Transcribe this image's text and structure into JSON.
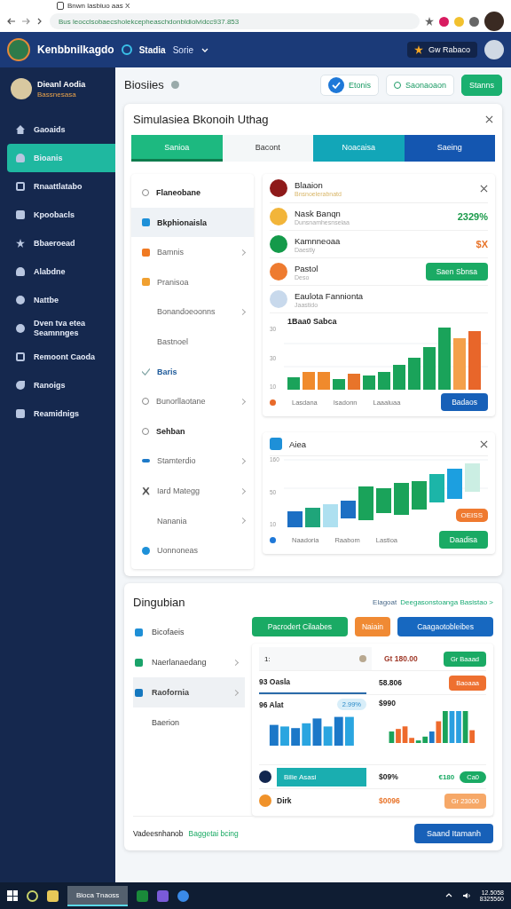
{
  "browser": {
    "tab_title": "Bnwn lasbiuo aas X",
    "url": "Bus leocclsobaecsholekcepheaschdonbldiolvidcc937.853"
  },
  "header": {
    "brand": "Kenbbnilkagdo",
    "nav": [
      {
        "label": "Stadia",
        "selected": true
      },
      {
        "label": "Sorie",
        "selected": false
      }
    ],
    "user": "Gw Rabaco"
  },
  "sidebar": {
    "profile": {
      "name": "Dieanl Aodia",
      "role": "Bassnesasa"
    },
    "items": [
      {
        "label": "Gaoaids",
        "selected": false
      },
      {
        "label": "Bioanis",
        "selected": true
      },
      {
        "label": "Rnaattlatabo",
        "selected": false
      },
      {
        "label": "Kpoobacls",
        "selected": false
      },
      {
        "label": "Bbaeroead",
        "selected": false
      },
      {
        "label": "Alabdne",
        "selected": false
      },
      {
        "label": "Nattbe",
        "selected": false
      },
      {
        "label": "Dven tva etea Seamnnges",
        "selected": false
      },
      {
        "label": "Remoont Caoda",
        "selected": false
      },
      {
        "label": "Ranoigs",
        "selected": false
      },
      {
        "label": "Reamidnigs",
        "selected": false
      }
    ]
  },
  "page": {
    "title": "Biosiies",
    "buttons": [
      {
        "label": "Etonis",
        "kind": "check"
      },
      {
        "label": "Saonaoaon",
        "kind": "outline"
      },
      {
        "label": "Stanns",
        "kind": "primary"
      }
    ]
  },
  "dialog": {
    "title": "Simulasiea Bkonoih Uthag",
    "tabs": [
      {
        "label": "Sanioa",
        "selected": true,
        "color": "#1db980"
      },
      {
        "label": "Bacont",
        "selected": false,
        "color": "#f4f7f8"
      },
      {
        "label": "Noacaisa",
        "selected": false,
        "color": "#12a6b8"
      },
      {
        "label": "Saeing",
        "selected": false,
        "color": "#1456b0"
      }
    ],
    "menu": [
      {
        "label": "Flaneobane",
        "arrow": false,
        "selected": false,
        "bold": true
      },
      {
        "label": "Bkphionaisla",
        "arrow": false,
        "selected": true,
        "bold": true
      },
      {
        "label": "Bamnis",
        "arrow": true,
        "selected": false,
        "bold": false
      },
      {
        "label": "Pranisoa",
        "arrow": false,
        "selected": false,
        "bold": false
      },
      {
        "label": "Bonandoeoonns",
        "arrow": true,
        "selected": false,
        "bold": false
      },
      {
        "label": "Bastnoel",
        "arrow": false,
        "selected": false,
        "bold": false
      },
      {
        "label": "Baris",
        "arrow": false,
        "selected": false,
        "bold": true
      },
      {
        "label": "Bunorllaotane",
        "arrow": true,
        "selected": false,
        "bold": false
      },
      {
        "label": "Sehban",
        "arrow": false,
        "selected": false,
        "bold": true
      },
      {
        "label": "Stamterdio",
        "arrow": true,
        "selected": false,
        "bold": false
      },
      {
        "label": "Iard Mategg",
        "arrow": true,
        "selected": false,
        "bold": false
      },
      {
        "label": "Nanania",
        "arrow": true,
        "selected": false,
        "bold": false
      },
      {
        "label": "Uonnoneas",
        "arrow": false,
        "selected": false,
        "bold": false
      }
    ],
    "card1": {
      "title": "Blaaion",
      "subtitle": "Bnsnoelerabnatd",
      "rows": [
        {
          "name": "Nask Banqn",
          "sub": "Dunsnamhesnseiaa",
          "color": "#f2b53a",
          "kind": "value",
          "value": "2329%"
        },
        {
          "name": "Kamnneoaa",
          "sub": "Daestly",
          "color": "#149a4a",
          "kind": "value",
          "value": "$X"
        },
        {
          "name": "Pastol",
          "sub": "Deso",
          "color": "#ee7b30",
          "kind": "button",
          "value": "Saen Sbnsa"
        },
        {
          "name": "Eaulota Fannionta",
          "sub": "Jaastido",
          "color": "#c8d9ec",
          "kind": "none"
        }
      ],
      "chart_caption": "1Baa0 Sabca",
      "yticks": [
        "30",
        "30",
        "10"
      ],
      "xlabels": [
        "Lasdana",
        "Isadonn",
        "Laaaluaa"
      ],
      "button": "Badaos"
    },
    "card2": {
      "title": "Aiea",
      "yticks": [
        "160",
        "50",
        "10"
      ],
      "badge": "OEISS",
      "xlabels": [
        "Naadoria",
        "Raabom",
        "Lastioa"
      ],
      "button": "Daadisa"
    }
  },
  "summary": {
    "title": "Dingubian",
    "link_label": "Elagoat",
    "link": "Deegasonstoanga Basistao >",
    "menu": [
      {
        "label": "Bicofaeis",
        "color": "#1e8fd6",
        "arrow": false,
        "selected": false
      },
      {
        "label": "Naerlanaedang",
        "color": "#1aa36a",
        "arrow": true,
        "selected": false
      },
      {
        "label": "Raofornia",
        "color": "#1578bf",
        "arrow": true,
        "selected": true
      },
      {
        "label": "Baerion",
        "arrow": false,
        "selected": false
      }
    ],
    "buttons": [
      {
        "label": "Pacrodert Cilaabes",
        "kind": "green"
      },
      {
        "label": "Naiain",
        "kind": "orange"
      },
      {
        "label": "Caagaotobleibes",
        "kind": "blue"
      }
    ],
    "panel": {
      "search": "1:",
      "price": "Gt 180.00",
      "price_button": "Gr Baaad",
      "row2_label": "93 Oasla",
      "row2_value": "58.806",
      "row2_badge": "Baoaaa",
      "row3_label": "96 Alat",
      "row3_pill": "2.99%",
      "row3_value": "$990",
      "bar_label": "Bilie Asasi",
      "row4_value": "$09%",
      "row4_delta": "€180",
      "row4_pill": "Ca0",
      "row5_label": "Dirk",
      "row5_value": "$0096",
      "row5_button": "Gr 23000"
    },
    "footer_label": "Vadeesnhanob",
    "footer_status": "Baggetai bcing",
    "footer_button": "Saand Itamanh"
  },
  "taskbar": {
    "window": "Bioca Tnaoss",
    "time": "12.5058",
    "date": "8325560"
  }
}
